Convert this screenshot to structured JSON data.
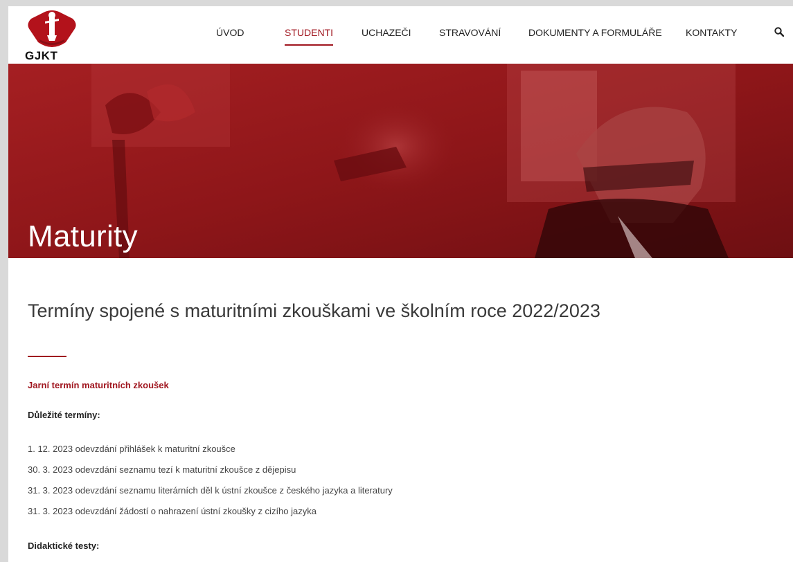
{
  "header": {
    "logo_text": "GJKT",
    "nav": [
      {
        "label": "ÚVOD",
        "active": false
      },
      {
        "label": "STUDENTI",
        "active": true
      },
      {
        "label": "UCHAZEČI",
        "active": false
      },
      {
        "label": "STRAVOVÁNÍ",
        "active": false
      },
      {
        "label": "DOKUMENTY A FORMULÁŘE",
        "active": false
      },
      {
        "label": "KONTAKTY",
        "active": false
      }
    ],
    "search_icon": "search-icon"
  },
  "hero": {
    "title": "Maturity"
  },
  "main": {
    "section_title": "Termíny spojené s maturitními zkouškami ve školním roce 2022/2023",
    "term_heading": "Jarní termín maturitních zkoušek",
    "important_heading": "Důležité termíny:",
    "important_items": [
      "1. 12. 2023 odevzdání přihlášek k maturitní zkoušce",
      "30. 3. 2023 odevzdání seznamu tezí k maturitní zkoušce z dějepisu",
      "31. 3. 2023 odevzdání seznamu literárních děl k ústní zkoušce z českého jazyka a literatury",
      "31. 3. 2023 odevzdání žádostí o nahrazení ústní zkoušky z cizího jazyka"
    ],
    "didactic_heading": "Didaktické testy:"
  },
  "colors": {
    "accent": "#a0161f",
    "hero_red": "#8e1a1c"
  }
}
